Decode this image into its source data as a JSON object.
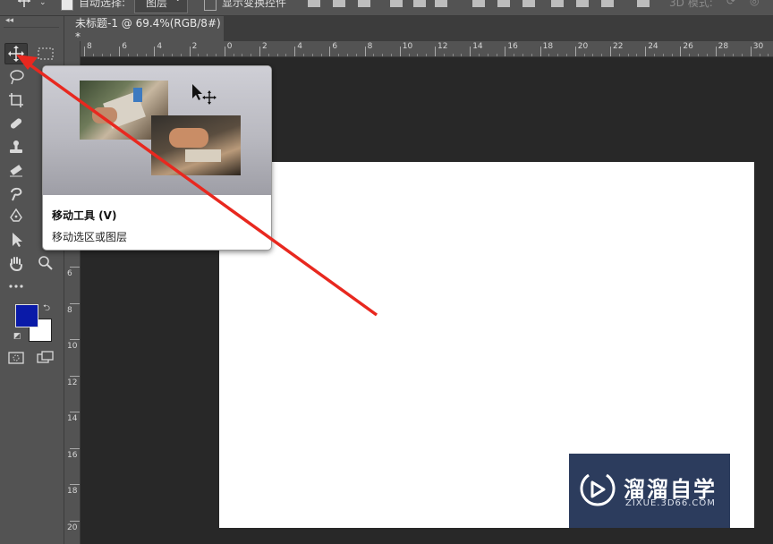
{
  "optionsbar": {
    "auto_select_label": "自动选择:",
    "layer_select_value": "图层",
    "show_transform_label": "显示变换控件",
    "mode_3d_label": "3D 模式:"
  },
  "document_tab": {
    "label": "未标题-1 @ 69.4%(RGB/8#) *"
  },
  "ruler_h": [
    "8",
    "6",
    "4",
    "2",
    "0",
    "2",
    "4",
    "6",
    "8",
    "10",
    "12",
    "14",
    "16",
    "18",
    "20",
    "22",
    "24",
    "26",
    "28",
    "30"
  ],
  "ruler_v": [
    "6",
    "8",
    "10",
    "12",
    "14",
    "16",
    "18",
    "20"
  ],
  "tooltip": {
    "title": "移动工具 (V)",
    "description": "移动选区或图层"
  },
  "colors": {
    "foreground": "#0a1aa8",
    "background": "#ffffff",
    "annotation_arrow": "#e8281f",
    "watermark_bg": "#2c3c5d"
  },
  "watermark": {
    "brand": "溜溜自学",
    "url": "ZIXUE.3D66.COM"
  },
  "tools": [
    "move-tool",
    "marquee-tool",
    "lasso-tool",
    "crop-tool",
    "healing-brush-tool",
    "stamp-tool",
    "eraser-tool",
    "smudge-tool",
    "pen-tool",
    "path-selection-tool",
    "hand-tool",
    "zoom-tool",
    "more-tools"
  ]
}
